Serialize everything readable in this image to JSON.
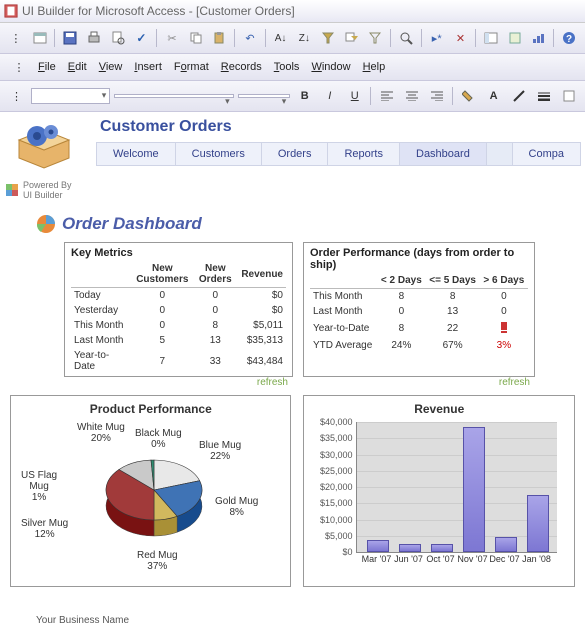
{
  "window": {
    "title": "UI Builder for Microsoft Access - [Customer Orders]"
  },
  "menus": {
    "file": "File",
    "edit": "Edit",
    "view": "View",
    "insert": "Insert",
    "format": "Format",
    "records": "Records",
    "tools": "Tools",
    "window": "Window",
    "help": "Help"
  },
  "toolbar": {
    "font": "",
    "size": ""
  },
  "header": {
    "title": "Customer Orders",
    "tabs": [
      "Welcome",
      "Customers",
      "Orders",
      "Reports",
      "Dashboard",
      "Compa"
    ],
    "activeTab": 4
  },
  "powered": {
    "line1": "Powered By",
    "line2": "UI Builder"
  },
  "dashboard_title": "Order Dashboard",
  "key_metrics": {
    "title": "Key Metrics",
    "cols": [
      "",
      "New Customers",
      "New Orders",
      "Revenue"
    ],
    "rows": [
      {
        "label": "Today",
        "c": "0",
        "o": "0",
        "r": "$0"
      },
      {
        "label": "Yesterday",
        "c": "0",
        "o": "0",
        "r": "$0"
      },
      {
        "label": "This Month",
        "c": "0",
        "o": "8",
        "r": "$5,011"
      },
      {
        "label": "Last Month",
        "c": "5",
        "o": "13",
        "r": "$35,313"
      },
      {
        "label": "Year-to-Date",
        "c": "7",
        "o": "33",
        "r": "$43,484"
      }
    ],
    "refresh": "refresh"
  },
  "order_perf": {
    "title": "Order Performance  (days from order to ship)",
    "cols": [
      "",
      "< 2 Days",
      "<= 5 Days",
      "> 6 Days"
    ],
    "rows": [
      {
        "label": "This Month",
        "a": "8",
        "b": "8",
        "c": "0"
      },
      {
        "label": "Last Month",
        "a": "0",
        "b": "13",
        "c": "0"
      },
      {
        "label": "Year-to-Date",
        "a": "8",
        "b": "22",
        "c": "",
        "warn": true
      },
      {
        "label": "YTD Average",
        "a": "24%",
        "b": "67%",
        "c": "3%",
        "cred": true
      }
    ],
    "refresh": "refresh"
  },
  "chart_data": [
    {
      "type": "pie",
      "title": "Product Performance",
      "series": [
        {
          "name": "White Mug",
          "value": 20,
          "color": "#e8e8e8"
        },
        {
          "name": "Black Mug",
          "value": 0,
          "color": "#333333"
        },
        {
          "name": "Blue Mug",
          "value": 22,
          "color": "#3f73b5"
        },
        {
          "name": "Gold Mug",
          "value": 8,
          "color": "#d1b85e"
        },
        {
          "name": "Red Mug",
          "value": 37,
          "color": "#a13a3a"
        },
        {
          "name": "Silver Mug",
          "value": 12,
          "color": "#c9c9c9"
        },
        {
          "name": "US Flag Mug",
          "value": 1,
          "color": "#2f8c70"
        }
      ]
    },
    {
      "type": "bar",
      "title": "Revenue",
      "ylabel": "",
      "ylim": [
        0,
        40000
      ],
      "y_ticks": [
        "$0",
        "$5,000",
        "$10,000",
        "$15,000",
        "$20,000",
        "$25,000",
        "$30,000",
        "$35,000",
        "$40,000"
      ],
      "categories": [
        "Mar '07",
        "Jun '07",
        "Oct '07",
        "Nov '07",
        "Dec '07",
        "Jan '08"
      ],
      "values": [
        3000,
        2000,
        2000,
        38000,
        4000,
        17000
      ]
    }
  ],
  "footer": "Your Business Name"
}
